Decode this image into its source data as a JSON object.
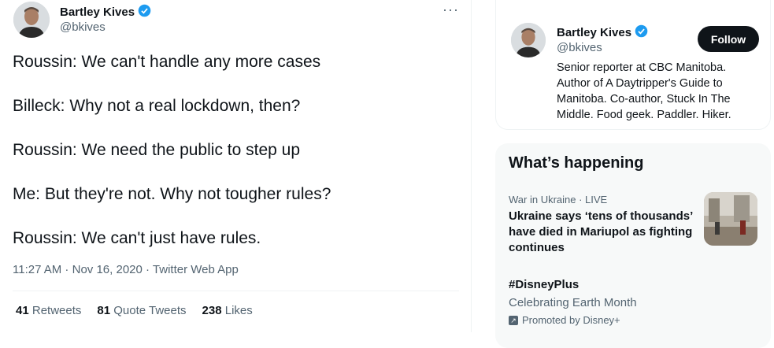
{
  "tweet": {
    "author_name": "Bartley Kives",
    "author_handle": "@bkives",
    "more_label": "···",
    "lines": [
      "Roussin: We can't handle any more cases",
      "Billeck: Why not a real lockdown, then?",
      "Roussin: We need the public to step up",
      "Me: But they're not. Why not tougher rules?",
      "Roussin: We can't just have rules."
    ],
    "time": "11:27 AM",
    "date": "Nov 16, 2020",
    "source": "Twitter Web App",
    "stats": {
      "retweets_count": "41",
      "retweets_label": "Retweets",
      "quotes_count": "81",
      "quotes_label": "Quote Tweets",
      "likes_count": "238",
      "likes_label": "Likes"
    }
  },
  "profile_card": {
    "name": "Bartley Kives",
    "handle": "@bkives",
    "follow_label": "Follow",
    "bio": "Senior reporter at CBC Manitoba. Author of A Daytripper's Guide to Manitoba. Co-author, Stuck In The Middle. Food geek. Paddler. Hiker."
  },
  "trends": {
    "title": "What’s happening",
    "items": [
      {
        "meta": "War in Ukraine · LIVE",
        "headline": "Ukraine says ‘tens of thousands’ have died in Mariupol as fighting continues"
      },
      {
        "hashtag": "#DisneyPlus",
        "subtitle": "Celebrating Earth Month",
        "promoted": "Promoted by Disney+"
      }
    ]
  },
  "colors": {
    "verified": "#1d9bf0",
    "text_secondary": "#536471",
    "follow_bg": "#0f1419"
  }
}
